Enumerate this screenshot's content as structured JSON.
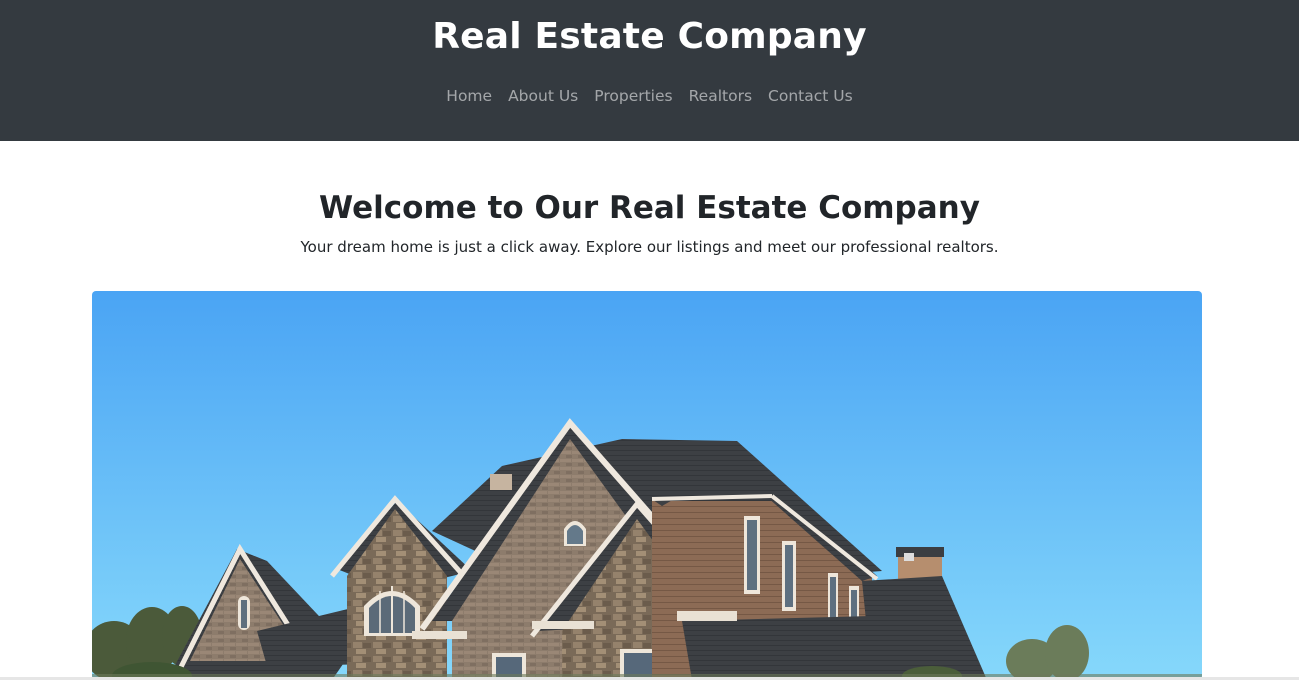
{
  "header": {
    "title": "Real Estate Company",
    "nav": [
      {
        "label": "Home"
      },
      {
        "label": "About Us"
      },
      {
        "label": "Properties"
      },
      {
        "label": "Realtors"
      },
      {
        "label": "Contact Us"
      }
    ],
    "background": "#343a40"
  },
  "main": {
    "welcome_title": "Welcome to Our Real Estate Company",
    "welcome_subtitle": "Your dream home is just a click away. Explore our listings and meet our professional realtors.",
    "hero_image": {
      "subject": "house-photo"
    }
  },
  "colors": {
    "sky_top": "#4aa3f5",
    "sky_bottom": "#7fd3fb",
    "roof": "#3c3f43",
    "brick": "#8b7a6a",
    "siding": "#8a6a55",
    "trim": "#f2ece2"
  }
}
